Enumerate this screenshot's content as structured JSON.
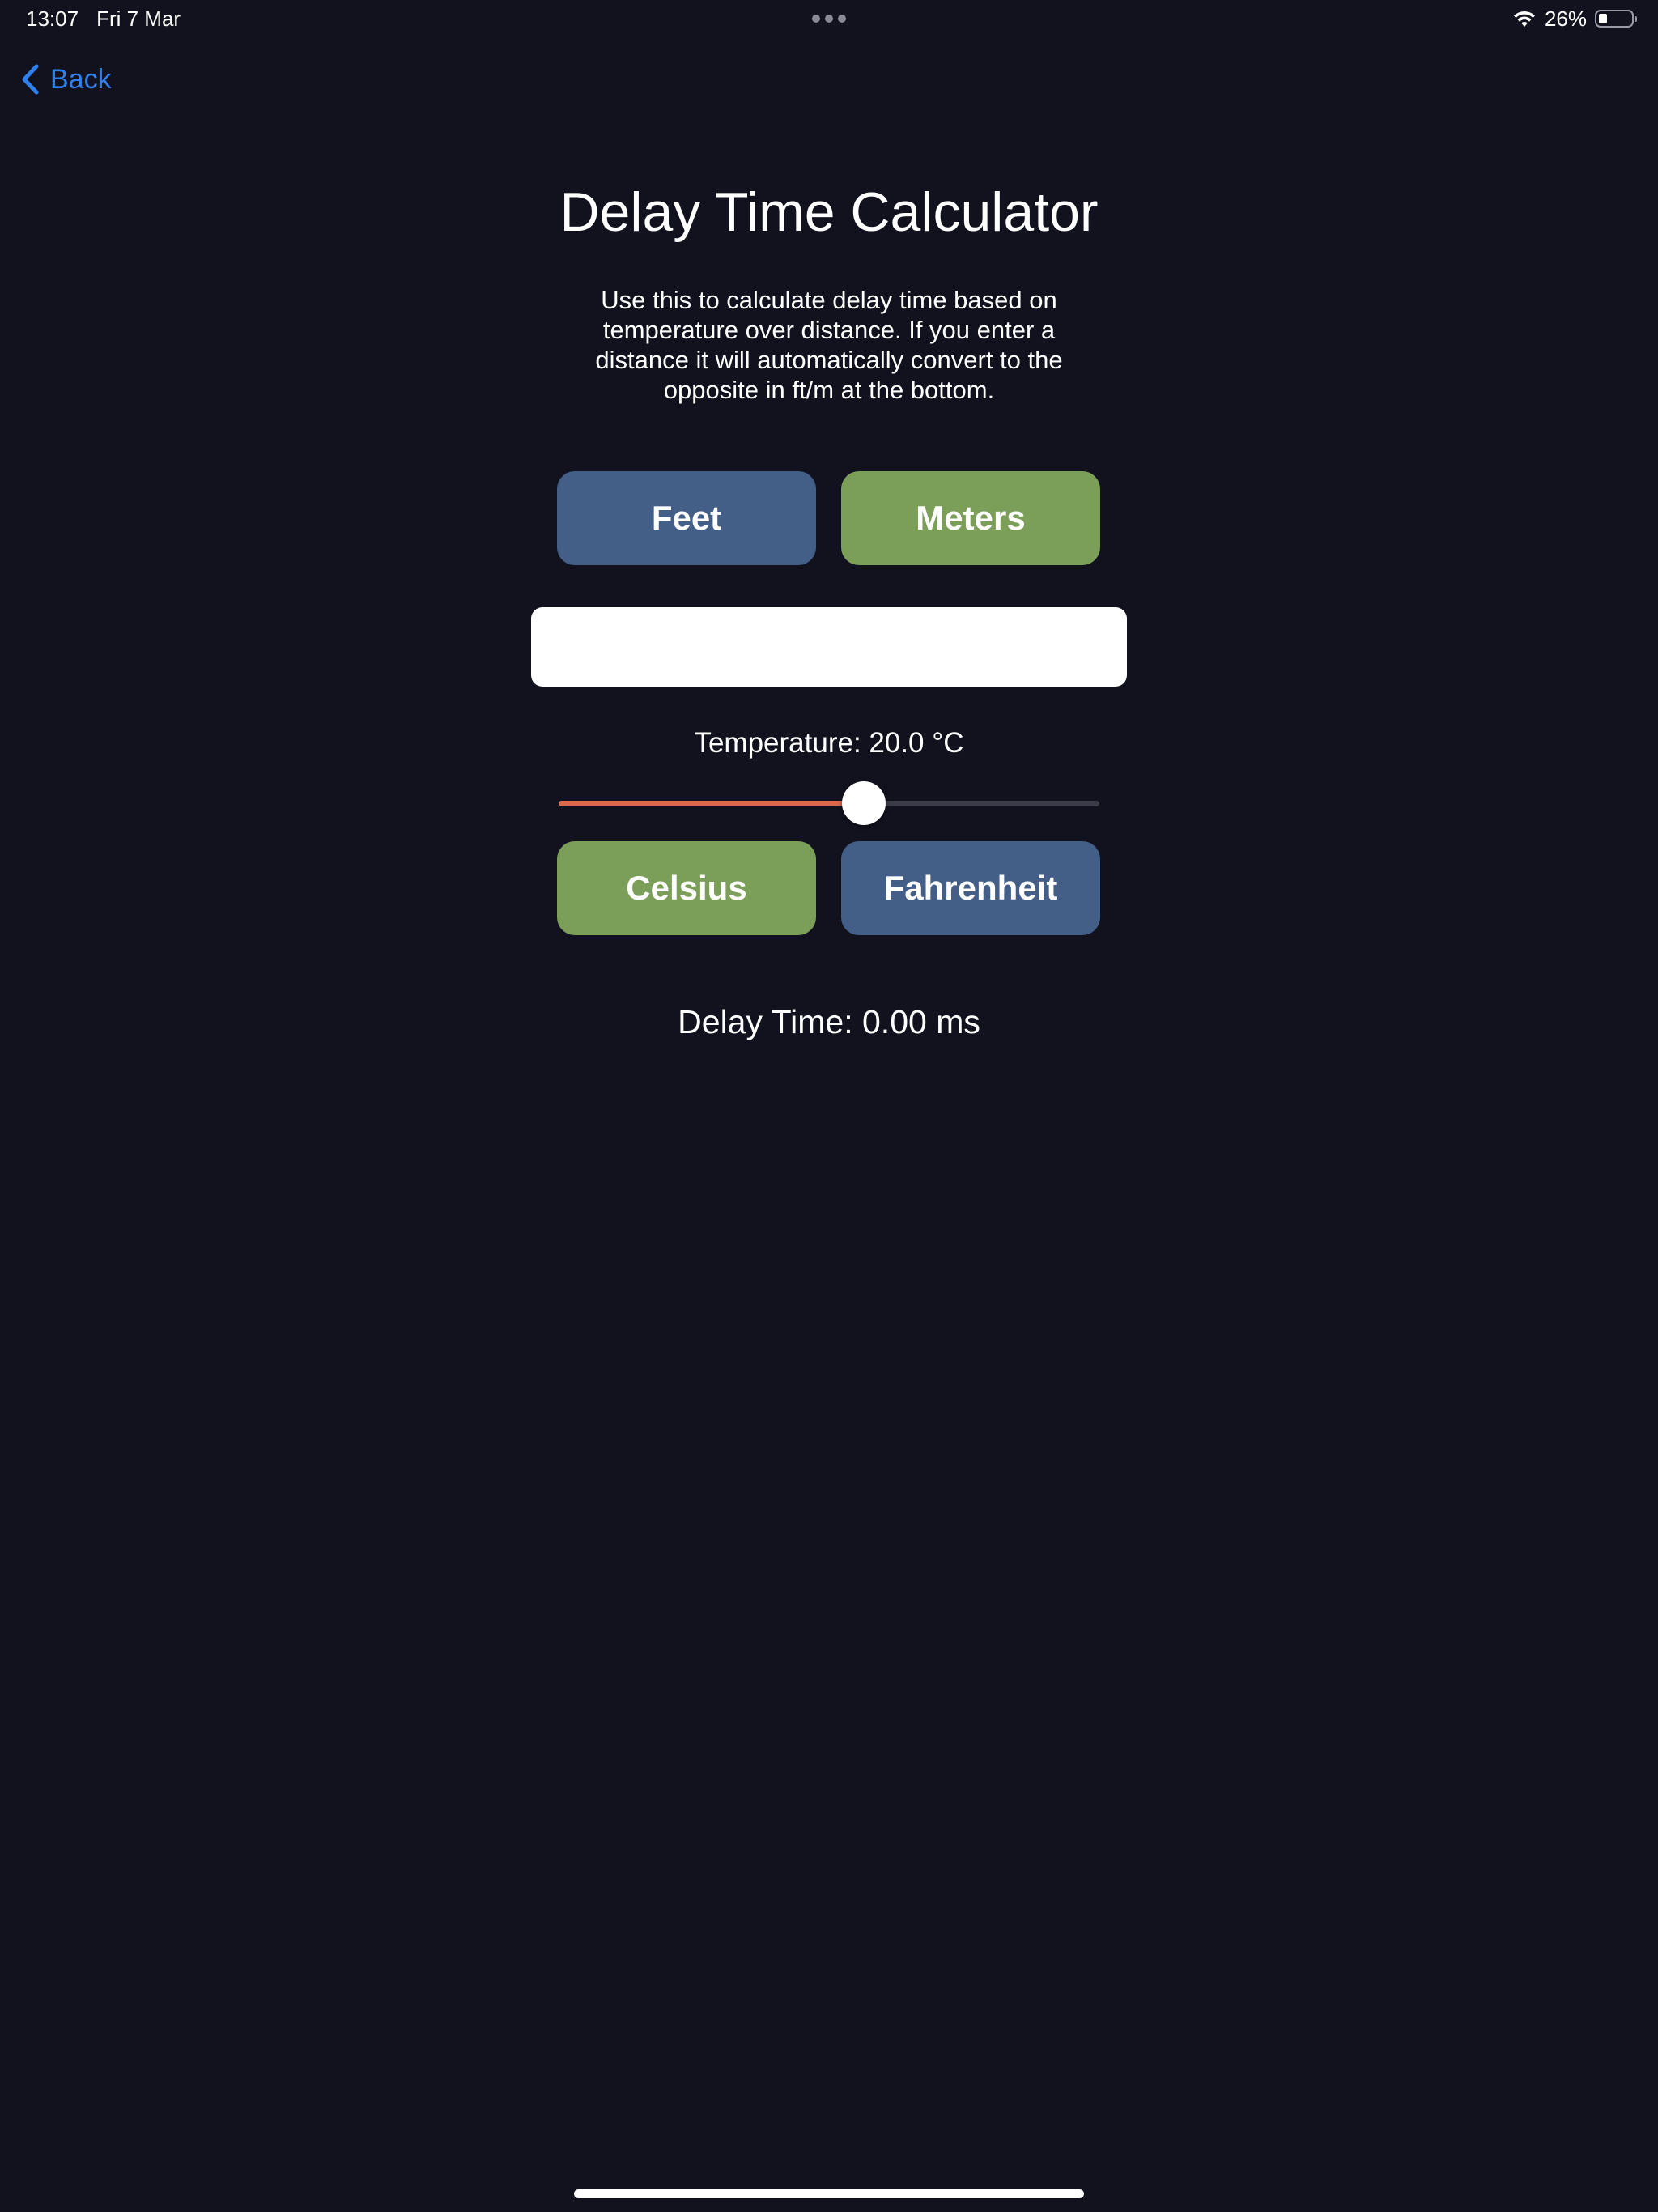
{
  "status_bar": {
    "time": "13:07",
    "date": "Fri 7 Mar",
    "battery_percent": "26%",
    "battery_level": 0.26
  },
  "nav": {
    "back_label": "Back"
  },
  "page": {
    "title": "Delay Time Calculator",
    "description": "Use this to calculate delay time based on temperature over distance. If you enter a distance it will automatically convert to the opposite in ft/m at the bottom."
  },
  "distance_units": {
    "feet_label": "Feet",
    "meters_label": "Meters",
    "selected": "Meters"
  },
  "distance_input": {
    "value": "",
    "placeholder": ""
  },
  "temperature": {
    "label": "Temperature: 20.0 °C",
    "slider_fraction": 0.565,
    "celsius_label": "Celsius",
    "fahrenheit_label": "Fahrenheit",
    "selected_unit": "Celsius"
  },
  "result": {
    "delay_label": "Delay Time: 0.00 ms"
  },
  "colors": {
    "background": "#12121f",
    "accent_blue": "#2f80ed",
    "button_blue": "#445f87",
    "button_green": "#7b9e59",
    "slider_fill": "#d9694a",
    "slider_track": "#3a3a48"
  }
}
